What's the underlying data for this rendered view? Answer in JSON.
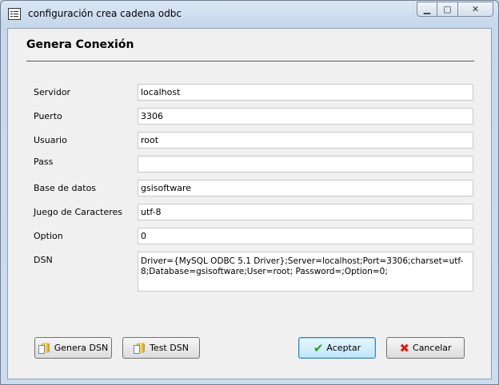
{
  "window": {
    "title": "configuración crea cadena odbc",
    "min_label": "▁",
    "max_label": "▢",
    "close_label": "✕"
  },
  "form": {
    "heading": "Genera Conexión",
    "fields": {
      "servidor": {
        "label": "Servidor",
        "value": "localhost"
      },
      "puerto": {
        "label": "Puerto",
        "value": "3306"
      },
      "usuario": {
        "label": "Usuario",
        "value": "root"
      },
      "pass": {
        "label": "Pass",
        "value": ""
      },
      "base_datos": {
        "label": "Base de datos",
        "value": "gsisoftware"
      },
      "juego_caracteres": {
        "label": "Juego de Caracteres",
        "value": "utf-8"
      },
      "option": {
        "label": "Option",
        "value": "0"
      },
      "dsn": {
        "label": "DSN",
        "value": "Driver={MySQL ODBC 5.1 Driver};Server=localhost;Port=3306;charset=utf-8;Database=gsisoftware;User=root; Password=;Option=0;"
      }
    }
  },
  "buttons": {
    "genera_dsn": "Genera DSN",
    "test_dsn": "Test DSN",
    "aceptar": "Aceptar",
    "cancelar": "Cancelar"
  },
  "icons": {
    "app": "form-window-icon",
    "genera": "database-document-icon",
    "test": "database-document-icon",
    "aceptar": "checkmark-icon",
    "cancelar": "red-x-icon"
  }
}
